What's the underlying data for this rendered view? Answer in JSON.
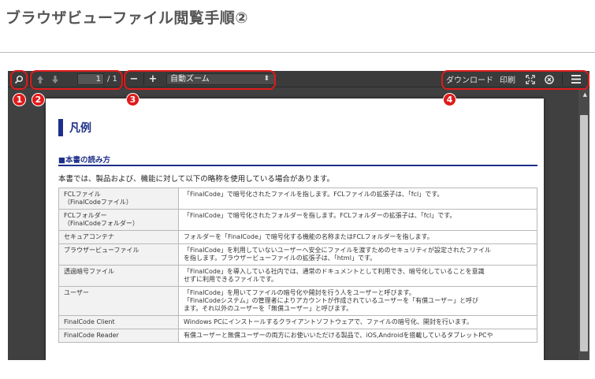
{
  "page": {
    "title": "ブラウザビューファイル閲覧手順②"
  },
  "toolbar": {
    "search_icon": "search-icon",
    "prev_icon": "arrow-up-icon",
    "next_icon": "arrow-down-icon",
    "page_number": "1",
    "page_total": "/ 1",
    "zoom_out": "−",
    "zoom_in": "+",
    "zoom_value": "自動ズーム",
    "zoom_caret": "⬍",
    "download": "ダウンロード",
    "print": "印刷",
    "fullscreen": "⛶",
    "close": "⊗",
    "menu": "☰"
  },
  "badges": [
    "1",
    "2",
    "3",
    "4"
  ],
  "document": {
    "heading": "凡例",
    "subheading": "■本書の読み方",
    "intro": "本書では、製品および、機能に対して以下の略称を使用している場合があります。",
    "rows": [
      {
        "term": "FCLファイル\n（FinalCodeファイル）",
        "desc": "「FinalCode」で暗号化されたファイルを指します。FCLファイルの拡張子は、「fcl」です。"
      },
      {
        "term": "FCLフォルダー\n（FinalCodeフォルダー）",
        "desc": "「FinalCode」で暗号化されたフォルダーを指します。FCLフォルダーの拡張子は、「fcl」です。"
      },
      {
        "term": "セキュアコンテナ",
        "desc": "フォルダーを「FinalCode」で暗号化する機能の名称またはFCLフォルダーを指します。"
      },
      {
        "term": "ブラウザービューファイル",
        "desc": "「FinalCode」を利用していないユーザーへ安全にファイルを渡すためのセキュリティが設定されたファイル\nを指します。ブラウザービューファイルの拡張子は、「html」です。"
      },
      {
        "term": "透過暗号ファイル",
        "desc": "「FinalCode」を導入している社内では、通常のドキュメントとして利用でき、暗号化していることを意識\nせずに利用できるファイルです。"
      },
      {
        "term": "ユーザー",
        "desc": "「FinalCode」を用いてファイルの暗号化や開封を行う人をユーザーと呼びます。\n「FinalCodeシステム」の管理者によりアカウントが作成されているユーザーを「有償ユーザー」と呼び\nます。それ以外のユーザーを「無償ユーザー」と呼びます。"
      },
      {
        "term": "FinalCode Client",
        "desc": "Windows PCにインストールするクライアントソフトウェアで、ファイルの暗号化、開封を行います。"
      },
      {
        "term": "FinalCode Reader",
        "desc": "有償ユーザーと無償ユーザーの両方にお使いいただける製品で、iOS,Androidを搭載しているタブレットPCや"
      }
    ]
  },
  "colors": {
    "highlight": "#e01a1a",
    "heading_blue": "#1e2f8a",
    "toolbar_bg": "#3b3b3b"
  }
}
